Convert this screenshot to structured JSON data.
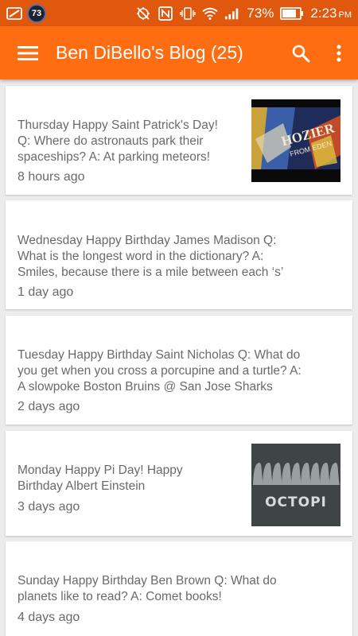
{
  "status_bar": {
    "notification_count": "73",
    "battery": "73%",
    "time": "2:23",
    "time_suffix": "PM",
    "icons": [
      "picture-icon",
      "notification-badge",
      "mute-icon",
      "nfc-icon",
      "vibrate-icon",
      "wifi-icon",
      "signal-icon",
      "battery-icon"
    ]
  },
  "app_bar": {
    "title": "Ben DiBello's Blog (25)",
    "menu_icon": "hamburger-menu-icon",
    "search_icon": "search-icon",
    "more_icon": "more-vert-icon"
  },
  "posts": [
    {
      "lines": [
        "Thursday Happy Saint Patrick's Day!",
        "Q: Where do astronauts park their",
        "spaceships? A: At parking meteors!"
      ],
      "time": "8 hours ago",
      "thumbnail": "hozier-album-art",
      "thumbnail_text": "HOZIER"
    },
    {
      "lines": [
        "Wednesday Happy Birthday James Madison Q:",
        "What is the longest word in the dictionary? A:",
        "Smiles, because there is a mile between each ‘s’"
      ],
      "time": "1 day ago"
    },
    {
      "lines": [
        "Tuesday Happy Birthday Saint Nicholas Q: What do",
        "you get when you cross a porcupine and a turtle? A:",
        "A slowpoke Boston Bruins @ San Jose Sharks"
      ],
      "time": "2 days ago"
    },
    {
      "lines": [
        "Monday Happy Pi Day! Happy",
        "Birthday Albert Einstein"
      ],
      "time": "3 days ago",
      "thumbnail": "octopi-logo",
      "thumbnail_text": "OCTOPI"
    },
    {
      "lines": [
        "Sunday Happy Birthday Ben Brown Q: What do",
        "planets like to read? A: Comet books!"
      ],
      "time": "4 days ago"
    }
  ],
  "colors": {
    "status_bar": "#e0580e",
    "app_bar": "#ff6d12",
    "background": "#ececec",
    "card": "#ffffff",
    "text": "#6a6a6a"
  }
}
